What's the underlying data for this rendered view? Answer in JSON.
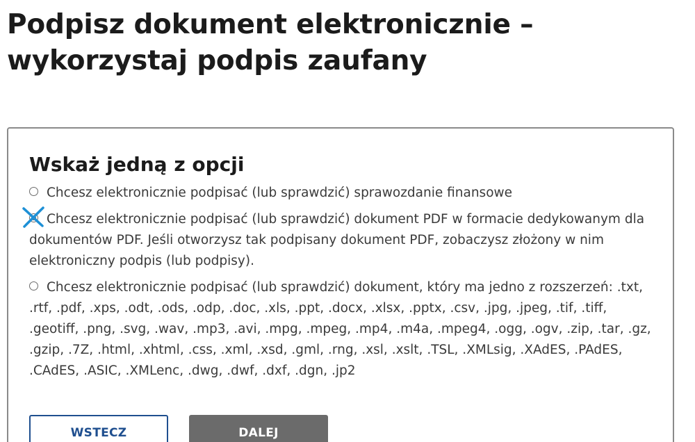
{
  "page": {
    "title": "Podpisz dokument elektronicznie – wykorzystaj podpis zaufany"
  },
  "form": {
    "heading": "Wskaż jedną z opcji",
    "options": [
      {
        "label": "Chcesz elektronicznie podpisać (lub sprawdzić) sprawozdanie finansowe",
        "selected": false
      },
      {
        "label": "Chcesz elektronicznie podpisać (lub sprawdzić) dokument PDF w formacie dedykowanym dla dokumentów PDF. Jeśli otworzysz tak podpisany dokument PDF, zobaczysz złożony w nim elektroniczny podpis (lub podpisy).",
        "selected": true
      },
      {
        "label": "Chcesz elektronicznie podpisać (lub sprawdzić) dokument, który ma jedno z rozszerzeń: .txt, .rtf, .pdf, .xps, .odt, .ods, .odp, .doc, .xls, .ppt, .docx, .xlsx, .pptx, .csv, .jpg, .jpeg, .tif, .tiff, .geotiff, .png, .svg, .wav, .mp3, .avi, .mpg, .mpeg, .mp4, .m4a, .mpeg4, .ogg, .ogv, .zip, .tar, .gz, .gzip, .7Z, .html, .xhtml, .css, .xml, .xsd, .gml, .rng, .xsl, .xslt, .TSL, .XMLsig, .XAdES, .PAdES, .CAdES, .ASIC, .XMLenc, .dwg, .dwf, .dxf, .dgn, .jp2",
        "selected": false
      }
    ],
    "back_label": "WSTECZ",
    "next_label": "DALEJ"
  },
  "colors": {
    "text": "#1b1b1b",
    "option_text": "#3a3a3a",
    "panel_border": "#8a8a8a",
    "back_button": "#1f4f8f",
    "next_button": "#6b6b6b",
    "selection_mark": "#1e90d6"
  }
}
